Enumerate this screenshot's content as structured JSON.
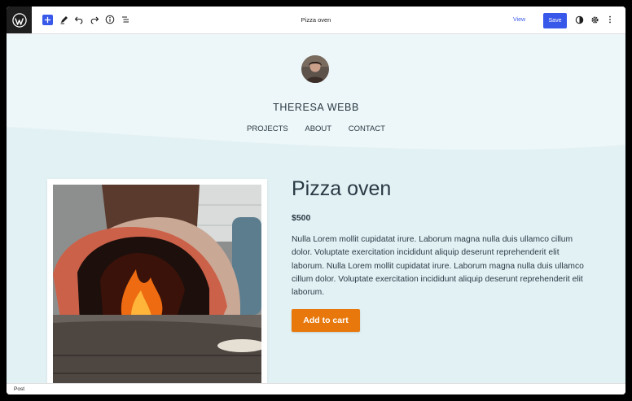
{
  "toolbar": {
    "document_title": "Pizza oven",
    "view_label": "View",
    "save_label": "Save"
  },
  "site": {
    "title": "THERESA WEBB",
    "nav": [
      "PROJECTS",
      "ABOUT",
      "CONTACT"
    ]
  },
  "product": {
    "title": "Pizza oven",
    "price": "$500",
    "description": "Nulla Lorem mollit cupidatat irure. Laborum magna nulla duis ullamco cillum dolor. Voluptate exercitation incididunt aliquip deserunt reprehenderit elit laborum. Nulla Lorem mollit cupidatat irure. Laborum magna nulla duis ullamco cillum dolor. Voluptate exercitation incididunt aliquip deserunt reprehenderit elit laborum.",
    "cta_label": "Add to cart"
  },
  "statusbar": {
    "label": "Post"
  },
  "colors": {
    "accent": "#3858e9",
    "cta": "#e8780b",
    "canvas": "#e2f1f4",
    "text": "#2a3a44"
  },
  "icons": [
    "wordpress-logo-icon",
    "plus-icon",
    "pen-icon",
    "undo-icon",
    "redo-icon",
    "info-icon",
    "list-view-icon",
    "contrast-icon",
    "gear-icon",
    "more-vertical-icon"
  ]
}
